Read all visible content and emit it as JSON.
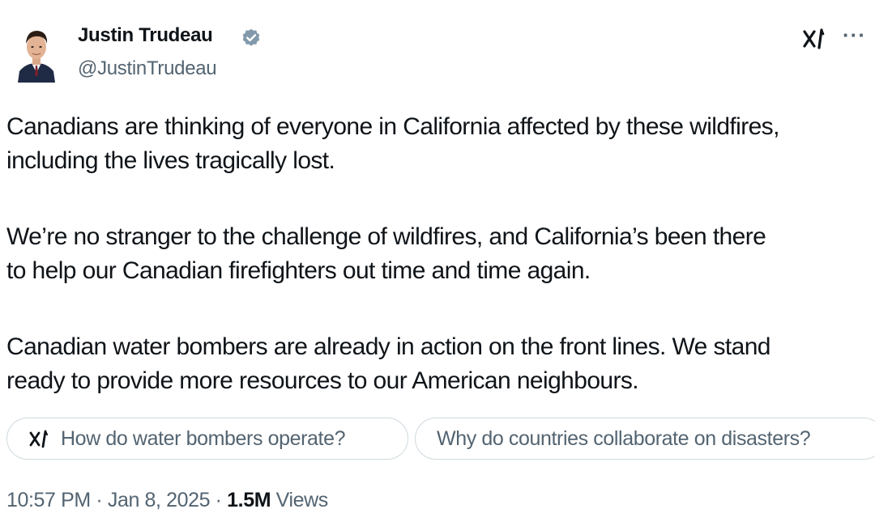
{
  "author": {
    "name": "Justin Trudeau",
    "handle": "@JustinTrudeau",
    "verified_color": "#829aab"
  },
  "header": {
    "grok_icon": "grok-icon",
    "more_glyph": "···"
  },
  "tweet": {
    "paragraphs": [
      {
        "line1": "Canadians are thinking of everyone in California affected by these wildfires,",
        "line2": "including the lives tragically lost."
      },
      {
        "line1": "We’re no stranger to the challenge of wildfires, and California’s been there",
        "line2": "to help our Canadian firefighters out time and time again."
      },
      {
        "line1": "Canadian water bombers are already in action on the front lines. We stand",
        "line2": "ready to provide more resources to our American neighbours."
      }
    ]
  },
  "suggestions": {
    "grok_glyph": "x𝗅",
    "items": [
      "How do water bombers operate?",
      "Why do countries collaborate on disasters?"
    ]
  },
  "meta": {
    "time": "10:57 PM",
    "separator": "·",
    "date": "Jan 8, 2025",
    "views_count": "1.5M",
    "views_label": "Views"
  }
}
